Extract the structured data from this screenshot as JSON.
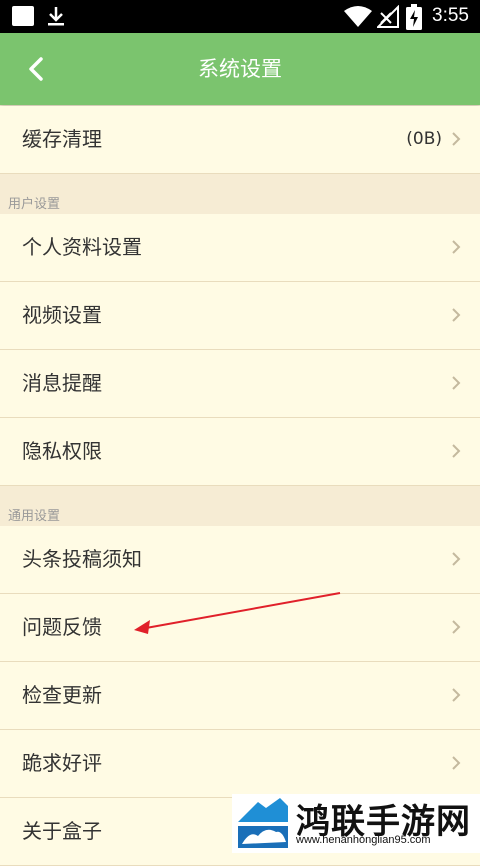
{
  "status_bar": {
    "time": "3:55"
  },
  "header": {
    "title": "系统设置"
  },
  "cache": {
    "label": "缓存清理",
    "value": "(0B)"
  },
  "sections": {
    "user": {
      "header": "用户设置",
      "items": [
        "个人资料设置",
        "视频设置",
        "消息提醒",
        "隐私权限"
      ]
    },
    "general": {
      "header": "通用设置",
      "items": [
        "头条投稿须知",
        "问题反馈",
        "检查更新",
        "跪求好评",
        "关于盒子"
      ]
    }
  },
  "watermark": {
    "brand": "鸿联手游网",
    "url": "www.henanhonglian95.com"
  },
  "colors": {
    "appbar": "#7bc46e",
    "row_bg": "#fffbe4",
    "page_bg": "#f6ecd4",
    "annotation_arrow": "#e0202a"
  }
}
